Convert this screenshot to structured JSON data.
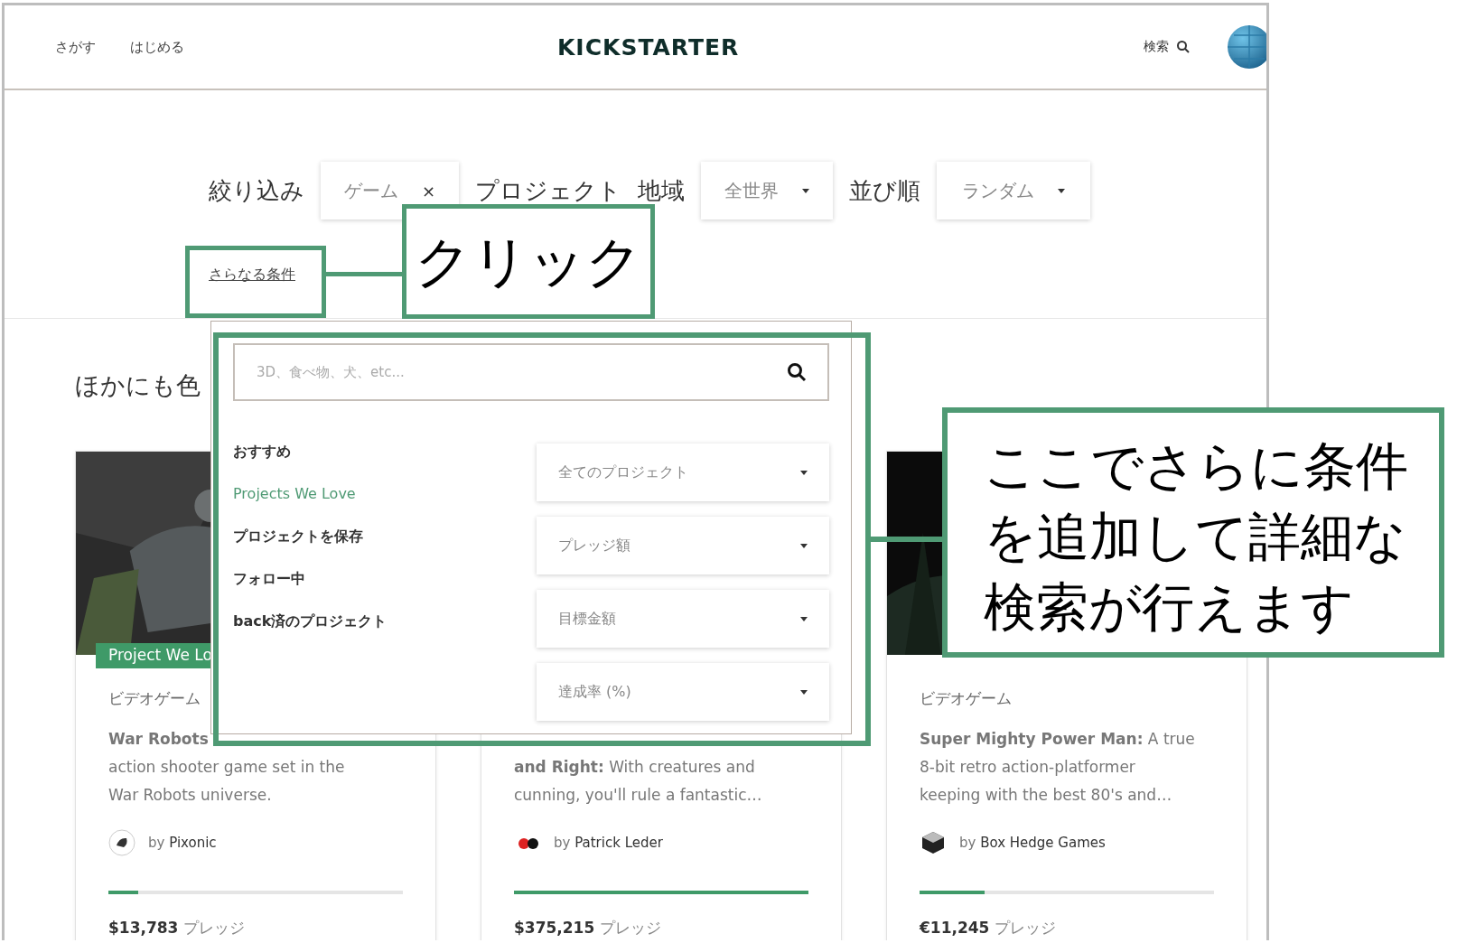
{
  "nav": {
    "links": [
      "さがす",
      "はじめる"
    ],
    "logo": "KICKSTARTER",
    "search": "検索"
  },
  "filters": {
    "label": "絞り込み",
    "category": "ゲーム",
    "clear": "×",
    "projects_label": "プロジェクト",
    "region_label": "地域",
    "region": "全世界",
    "sort_label": "並び順",
    "sort": "ランダム",
    "more_link": "さらなる条件"
  },
  "section_heading": "ほかにも色",
  "cards": [
    {
      "badge": "Project We Lo",
      "category": "ビデオゲーム",
      "lines": [
        "**War Robots**",
        "action shooter game set in the",
        "War Robots universe."
      ],
      "by": "by",
      "creator": "Pixonic",
      "level": 0.1,
      "pledged": "$13,783",
      "pledge_label": "プレッジ"
    },
    {
      "lines": [
        "**and Right:** With creatures and",
        "cunning, you'll rule a fantastic…"
      ],
      "by": "by",
      "creator": "Patrick Leder",
      "level": 1.0,
      "pledged": "$375,215",
      "pledge_label": "プレッジ"
    },
    {
      "category": "ビデオゲーム",
      "lines": [
        "**Super Mighty Power Man:** A true",
        "8-bit retro action-platformer",
        "keeping with the best 80's and…"
      ],
      "by": "by",
      "creator": "Box Hedge Games",
      "level": 0.22,
      "pledged": "€11,245",
      "pledge_label": "プレッジ"
    }
  ],
  "dropdown": {
    "placeholder": "3D、食べ物、犬、etc...",
    "items": [
      {
        "label": "おすすめ",
        "selected": false
      },
      {
        "label": "Projects We Love",
        "selected": true
      },
      {
        "label": "プロジェクトを保存",
        "selected": false
      },
      {
        "label": "フォロー中",
        "selected": false
      },
      {
        "label": "back済のプロジェクト",
        "selected": false
      }
    ],
    "selects": [
      "全てのプロジェクト",
      "プレッジ額",
      "目標金額",
      "達成率 (%)"
    ]
  },
  "annotations": [
    {
      "kind": "small",
      "text": "クリック"
    },
    {
      "kind": "large",
      "text": "ここでさらに条件を追加して詳細な検索が行えます"
    }
  ]
}
